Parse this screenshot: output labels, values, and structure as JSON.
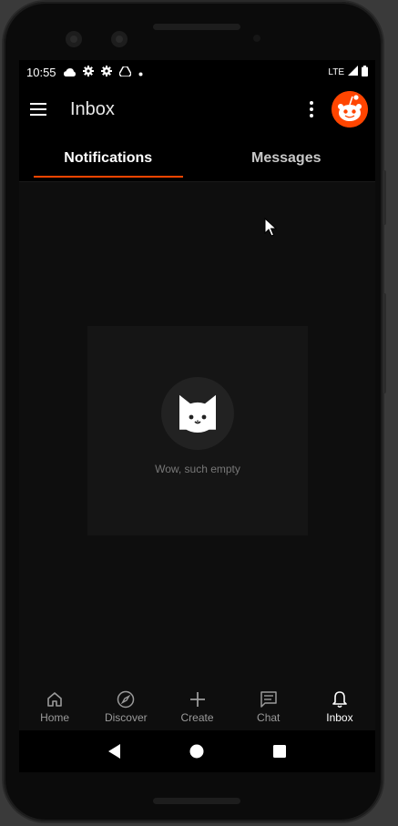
{
  "status_bar": {
    "time": "10:55",
    "network": "LTE",
    "icons": [
      "cloud-icon",
      "gear-icon",
      "gear-icon",
      "drive-icon",
      "dot-icon"
    ]
  },
  "app_bar": {
    "title": "Inbox"
  },
  "tabs": [
    {
      "label": "Notifications",
      "active": true
    },
    {
      "label": "Messages",
      "active": false
    }
  ],
  "empty_state": {
    "text": "Wow, such empty"
  },
  "bottom_nav": [
    {
      "label": "Home",
      "icon": "home-icon",
      "active": false
    },
    {
      "label": "Discover",
      "icon": "compass-icon",
      "active": false
    },
    {
      "label": "Create",
      "icon": "plus-icon",
      "active": false
    },
    {
      "label": "Chat",
      "icon": "chat-icon",
      "active": false
    },
    {
      "label": "Inbox",
      "icon": "bell-icon",
      "active": true
    }
  ],
  "colors": {
    "accent": "#ff4500",
    "background": "#0e0e0e"
  }
}
